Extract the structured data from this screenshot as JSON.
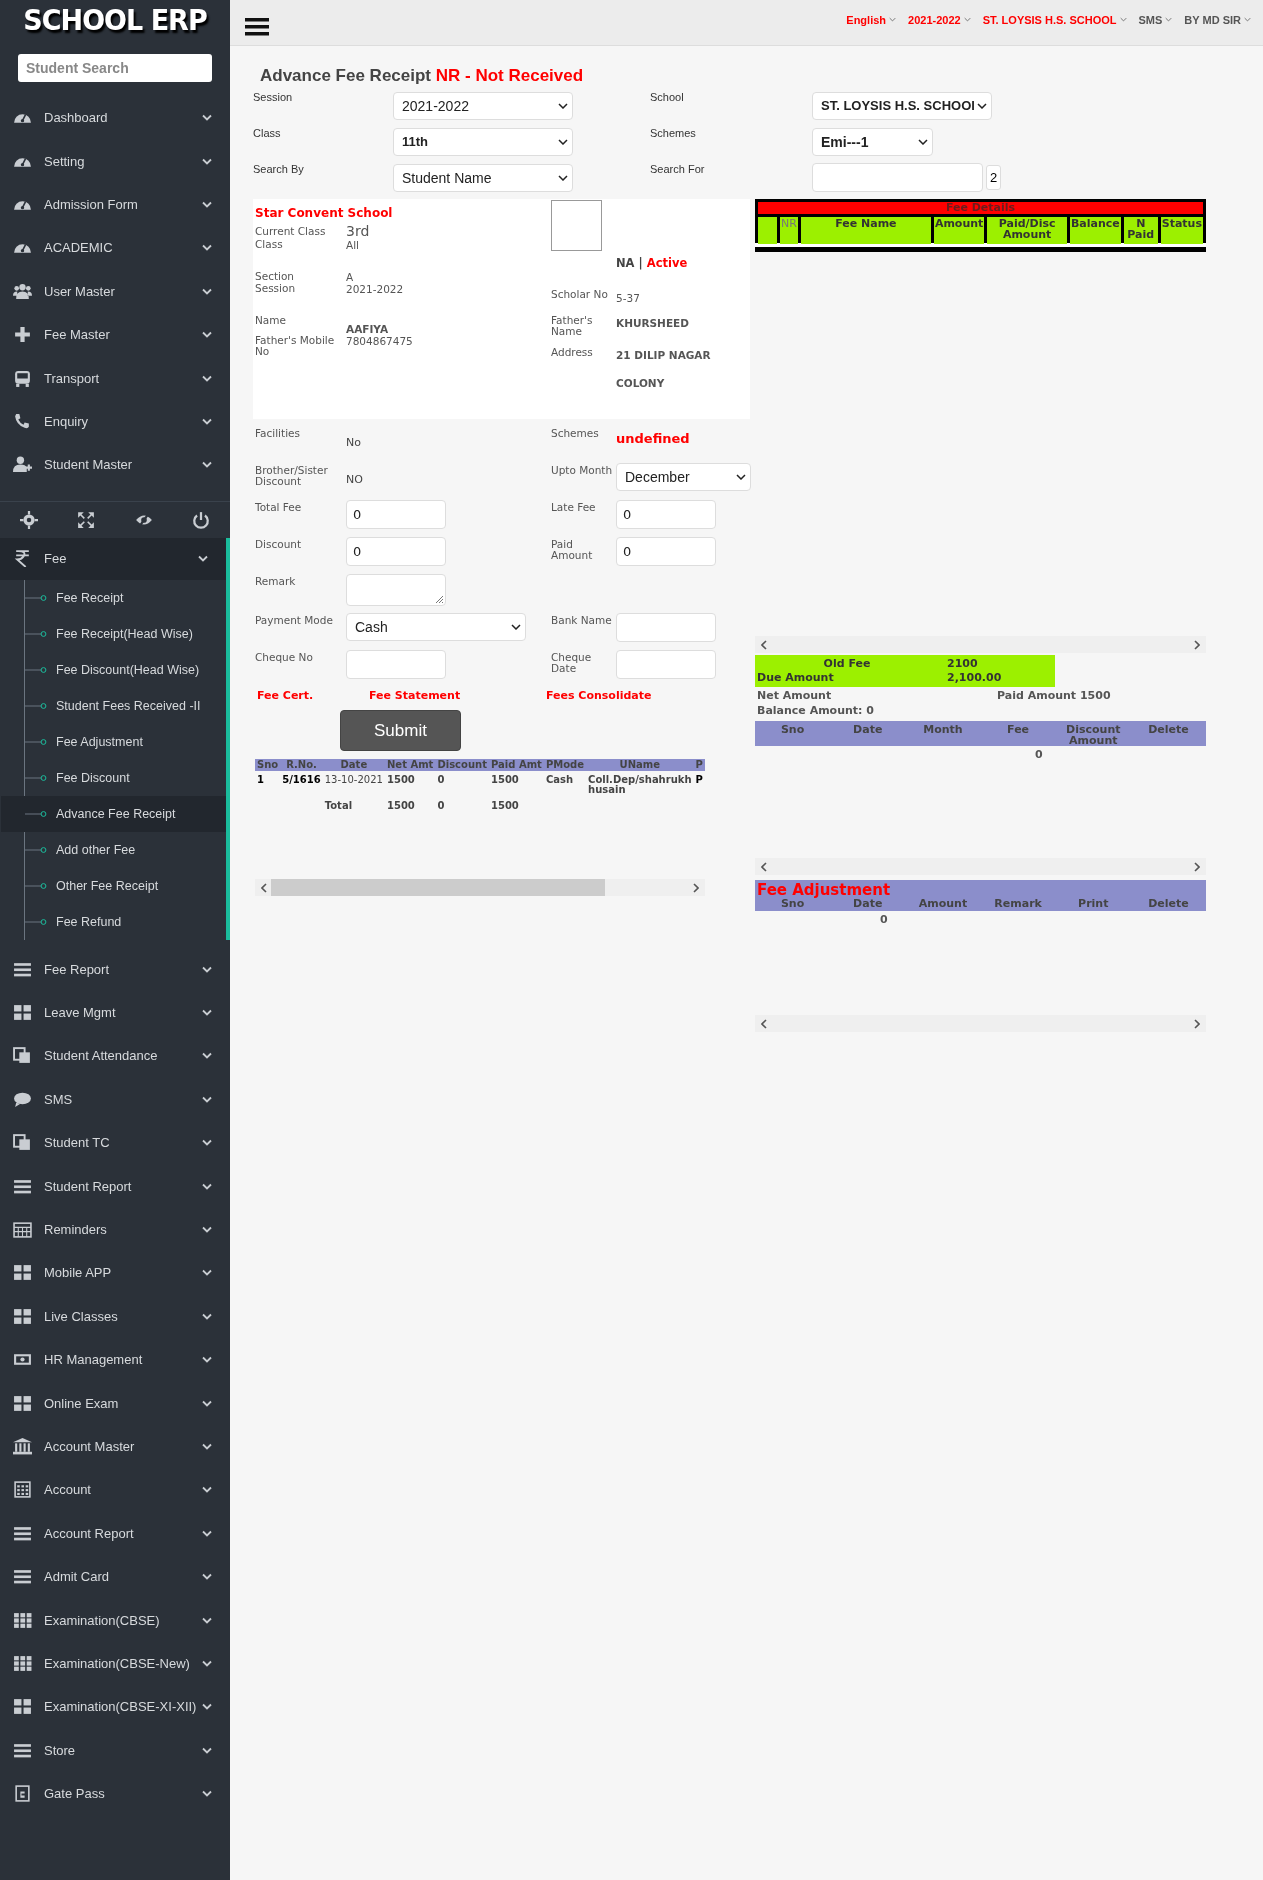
{
  "sidebar": {
    "logo": "SCHOOL ERP",
    "search": {
      "placeholder": "Student Search"
    },
    "menu_top": [
      {
        "label": "Dashboard"
      },
      {
        "label": "Setting"
      },
      {
        "label": "Admission Form"
      },
      {
        "label": "ACADEMIC"
      },
      {
        "label": "User Master"
      },
      {
        "label": "Fee Master"
      },
      {
        "label": "Transport"
      },
      {
        "label": "Enquiry"
      },
      {
        "label": "Student Master"
      }
    ],
    "open_menu": {
      "label": "Fee",
      "children": [
        {
          "label": "Fee Receipt",
          "selected": false
        },
        {
          "label": "Fee Receipt(Head Wise)",
          "selected": false
        },
        {
          "label": "Fee Discount(Head Wise)",
          "selected": false
        },
        {
          "label": "Student Fees Received -II",
          "selected": false
        },
        {
          "label": "Fee Adjustment",
          "selected": false
        },
        {
          "label": "Fee Discount",
          "selected": false
        },
        {
          "label": "Advance Fee Receipt",
          "selected": true
        },
        {
          "label": "Add other Fee",
          "selected": false
        },
        {
          "label": "Other Fee Receipt",
          "selected": false
        },
        {
          "label": "Fee Refund",
          "selected": false
        }
      ]
    },
    "menu_bottom": [
      {
        "label": "Fee Report"
      },
      {
        "label": "Leave Mgmt"
      },
      {
        "label": "Student Attendance"
      },
      {
        "label": "SMS"
      },
      {
        "label": "Student TC"
      },
      {
        "label": "Student Report"
      },
      {
        "label": "Reminders"
      },
      {
        "label": "Mobile APP"
      },
      {
        "label": "Live Classes"
      },
      {
        "label": "HR Management"
      },
      {
        "label": "Online Exam"
      },
      {
        "label": "Account Master"
      },
      {
        "label": "Account"
      },
      {
        "label": "Account Report"
      },
      {
        "label": "Admit Card"
      },
      {
        "label": "Examination(CBSE)"
      },
      {
        "label": "Examination(CBSE-New)"
      },
      {
        "label": "Examination(CBSE-XI-XII)"
      },
      {
        "label": "Store"
      },
      {
        "label": "Gate Pass"
      }
    ]
  },
  "topbar": {
    "menu": [
      {
        "label": "English",
        "color": "#ff0000"
      },
      {
        "label": "2021-2022",
        "color": "#ff0000"
      },
      {
        "label": "ST. LOYSIS H.S. SCHOOL",
        "color": "#ff0000"
      },
      {
        "label": "SMS",
        "color": "#555555"
      },
      {
        "label": "BY MD SIR",
        "color": "#555555"
      }
    ]
  },
  "page": {
    "title": "Advance Fee Receipt",
    "title_note": "NR - Not Received"
  },
  "filters": [
    {
      "left": {
        "label": "Session",
        "kind": "select",
        "value": "2021-2022",
        "bold": false
      },
      "right": {
        "label": "School",
        "kind": "select",
        "value": "ST. LOYSIS H.S. SCHOOl",
        "bold": true
      }
    },
    {
      "left": {
        "label": "Class",
        "kind": "select",
        "value": "11th",
        "bold": true
      },
      "right": {
        "label": "Schemes",
        "kind": "select",
        "value": "Emi---1",
        "bold": true
      }
    },
    {
      "left": {
        "label": "Search By",
        "kind": "select",
        "value": "Student Name",
        "bold": false
      },
      "right": {
        "label": "Search For",
        "kind": "search",
        "count": "2"
      }
    }
  ],
  "student": {
    "school": "Star Convent School",
    "status_code": "NA",
    "separator": "|",
    "status": "Active",
    "left": [
      {
        "label": "Current Class",
        "value": "3rd",
        "kind": "large"
      },
      {
        "label": "Class",
        "value": "All",
        "kind": "plain"
      },
      {
        "label": "Section",
        "value": "A",
        "kind": "plain"
      },
      {
        "label": "Session",
        "value": "2021-2022",
        "kind": "plain"
      },
      {
        "label": "Name",
        "value": "AAFIYA",
        "kind": "bold"
      },
      {
        "label": "Father's Mobile No",
        "value": "7804867475",
        "kind": "plain"
      }
    ],
    "right": [
      {
        "label": "Scholar No",
        "value": "5-37"
      },
      {
        "label": "Father's Name",
        "value": "KHURSHEED"
      },
      {
        "label": "Address",
        "value": "21 DILIP NAGAR COLONY"
      }
    ]
  },
  "form_rows": [
    {
      "left": {
        "label": "Facilities",
        "kind": "bold",
        "value": "No"
      },
      "right": {
        "label": "Schemes",
        "kind": "alert",
        "value": "undefined"
      }
    },
    {
      "left": {
        "label": "Brother/Sister Discount",
        "kind": "bold",
        "value": "NO"
      },
      "right": {
        "label": "Upto Month",
        "kind": "select",
        "value": "December"
      }
    },
    {
      "left": {
        "label": "Total Fee",
        "kind": "input",
        "value": "0"
      },
      "right": {
        "label": "Late Fee",
        "kind": "input",
        "value": "0"
      }
    },
    {
      "left": {
        "label": "Discount",
        "kind": "input",
        "value": "0"
      },
      "right": {
        "label": "Paid Amount",
        "kind": "input",
        "value": "0"
      }
    },
    {
      "left": {
        "label": "Remark",
        "kind": "textarea"
      }
    },
    {
      "left": {
        "label": "Payment Mode",
        "kind": "select",
        "value": "Cash"
      },
      "right": {
        "label": "Bank Name",
        "kind": "input"
      }
    },
    {
      "left": {
        "label": "Cheque No",
        "kind": "input"
      },
      "right": {
        "label": "Cheque Date",
        "kind": "input"
      }
    }
  ],
  "links": [
    "Fee Cert.",
    "Fee Statement",
    "Fees Consolidate"
  ],
  "submit": "Submit",
  "receipts": {
    "columns": [
      "Sno",
      "R.No.",
      "Date",
      "Net Amt",
      "Discount",
      "Paid Amt",
      "PMode",
      "UName",
      "P"
    ],
    "rows": [
      [
        "1",
        "5/1616",
        "13-10-2021",
        "1500",
        "0",
        "1500",
        "Cash",
        "Coll.Dep/shahrukh husain",
        "P"
      ]
    ],
    "total": {
      "label": "Total",
      "net": "1500",
      "discount": "0",
      "paid": "1500"
    }
  },
  "fee_details": {
    "title": "Fee Details",
    "columns": [
      "NR",
      "Fee Name",
      "Amount",
      "Paid/Disc Amount",
      "Balance",
      "N Paid",
      "Status"
    ]
  },
  "summary": {
    "old_fee_label": "Old Fee",
    "old_fee": "2100",
    "due_label": "Due Amount",
    "due": "2,100.00",
    "net_amount": "Net Amount",
    "paid_amount": "Paid Amount 1500",
    "balance": "Balance Amount: 0"
  },
  "installments": {
    "columns": [
      "Sno",
      "Date",
      "Month",
      "Fee",
      "Discount Amount",
      "Delete"
    ],
    "total": "0"
  },
  "adjustment": {
    "title": "Fee Adjustment",
    "columns": [
      "Sno",
      "Date",
      "Amount",
      "Remark",
      "Print",
      "Delete"
    ],
    "total": "0"
  }
}
